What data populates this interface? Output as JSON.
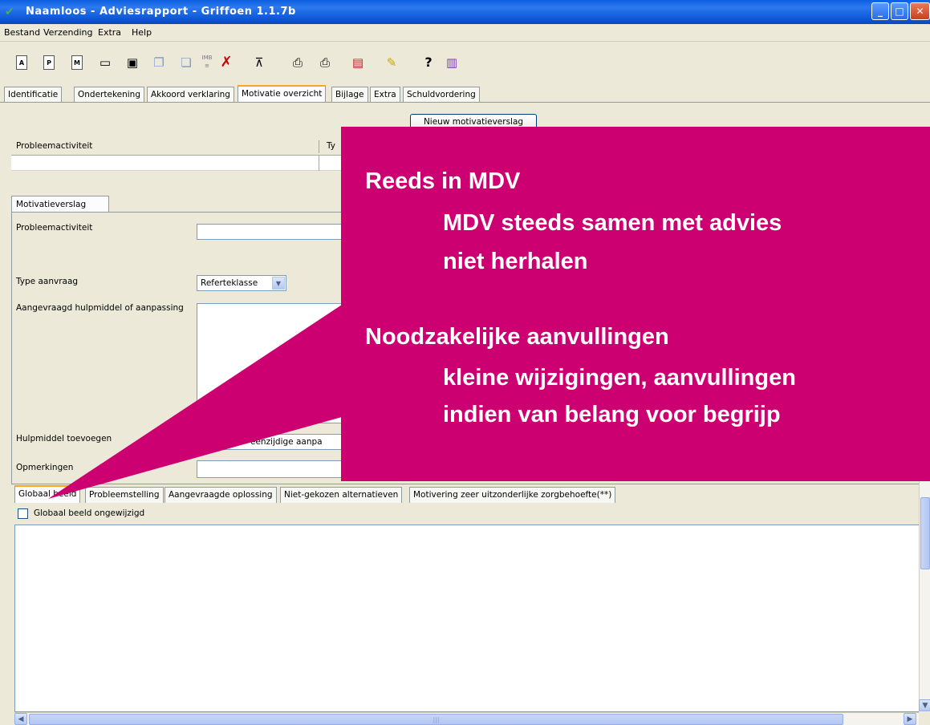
{
  "window": {
    "title": "Naamloos - Adviesrapport - Griffoen 1.1.7b"
  },
  "menu": [
    "Bestand",
    "Verzending",
    "Extra",
    "Help"
  ],
  "toolbar": {
    "icons": [
      "doc-a-icon",
      "doc-p-icon",
      "doc-m-icon",
      "open-folder-icon",
      "save-icon",
      "copy-icon",
      "paste-icon",
      "imb-icon",
      "delete-icon",
      "stamp-icon",
      "print-icon",
      "print-preview-icon",
      "pdf-icon",
      "signature-icon",
      "help-icon",
      "book-icon"
    ],
    "doc_letters": [
      "A",
      "P",
      "M"
    ],
    "help_label": "?",
    "imb_label": "IMB"
  },
  "tabs": [
    "Identificatie",
    "Ondertekening",
    "Akkoord verklaring",
    "Motivatie overzicht",
    "Bijlage",
    "Extra",
    "Schuldvordering"
  ],
  "active_tab": "Motivatie overzicht",
  "new_button": "Nieuw motivatieverslag",
  "table": {
    "columns": [
      "Probleemactiviteit",
      "Ty"
    ]
  },
  "subtab": "Motivatieverslag",
  "form": {
    "probleemactiviteit_label": "Probleemactiviteit",
    "type_label": "Type aanvraag",
    "type_value": "Referteklasse",
    "aangevraagd_label": "Aangevraagd hulpmiddel of aanpassing",
    "hulpmiddel_label": "Hulpmiddel toevoegen",
    "hulpmiddel_value": "eenzijdige aanpa",
    "opmerkingen_label": "Opmerkingen"
  },
  "bottom_tabs": [
    "Globaal beeld",
    "Probleemstelling",
    "Aangevraagde oplossing",
    "Niet-gekozen alternatieven",
    "Motivering zeer uitzonderlijke zorgbehoefte(**)"
  ],
  "checkbox_label": "Globaal beeld ongewijzigd",
  "callout": {
    "heading1": "Reeds in MDV",
    "line1": "MDV steeds samen met advies",
    "line2": "niet herhalen",
    "heading2": "Noodzakelijke aanvullingen",
    "line3": "kleine wijzigingen, aanvullingen",
    "line4": "indien van belang voor begrijp",
    "color": "#cc0070"
  },
  "colors": {
    "titlebar": "#0a5fe0",
    "background": "#ece9d8",
    "active_tab_accent": "#f5a623"
  }
}
